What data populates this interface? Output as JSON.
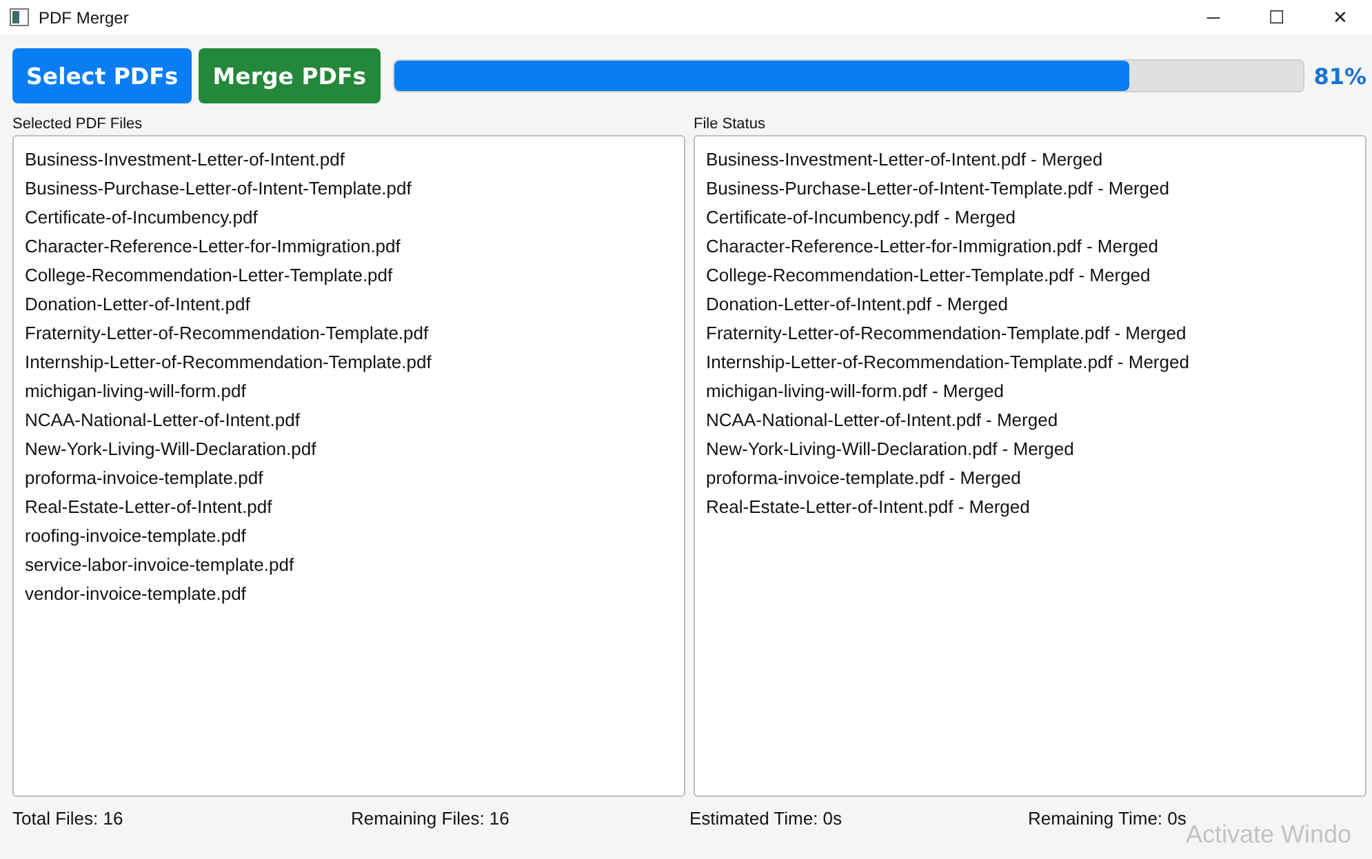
{
  "window": {
    "title": "PDF Merger",
    "controls": [
      "─",
      "☐",
      "✕"
    ]
  },
  "toolbar": {
    "buttons": [
      {
        "label": "Select PDFs",
        "kind": "primary"
      },
      {
        "label": "Merge PDFs",
        "kind": "success"
      }
    ],
    "progress": {
      "level": 0.81,
      "reading": "81%"
    }
  },
  "selected_files": {
    "label": "Selected PDF Files",
    "items": [
      "Business-Investment-Letter-of-Intent.pdf",
      "Business-Purchase-Letter-of-Intent-Template.pdf",
      "Certificate-of-Incumbency.pdf",
      "Character-Reference-Letter-for-Immigration.pdf",
      "College-Recommendation-Letter-Template.pdf",
      "Donation-Letter-of-Intent.pdf",
      "Fraternity-Letter-of-Recommendation-Template.pdf",
      "Internship-Letter-of-Recommendation-Template.pdf",
      "michigan-living-will-form.pdf",
      "NCAA-National-Letter-of-Intent.pdf",
      "New-York-Living-Will-Declaration.pdf",
      "proforma-invoice-template.pdf",
      "Real-Estate-Letter-of-Intent.pdf",
      "roofing-invoice-template.pdf",
      "service-labor-invoice-template.pdf",
      "vendor-invoice-template.pdf"
    ]
  },
  "file_status": {
    "label": "File Status",
    "items": [
      "Business-Investment-Letter-of-Intent.pdf - Merged",
      "Business-Purchase-Letter-of-Intent-Template.pdf - Merged",
      "Certificate-of-Incumbency.pdf - Merged",
      "Character-Reference-Letter-for-Immigration.pdf - Merged",
      "College-Recommendation-Letter-Template.pdf - Merged",
      "Donation-Letter-of-Intent.pdf - Merged",
      "Fraternity-Letter-of-Recommendation-Template.pdf - Merged",
      "Internship-Letter-of-Recommendation-Template.pdf - Merged",
      "michigan-living-will-form.pdf - Merged",
      "NCAA-National-Letter-of-Intent.pdf - Merged",
      "New-York-Living-Will-Declaration.pdf - Merged",
      "proforma-invoice-template.pdf - Merged",
      "Real-Estate-Letter-of-Intent.pdf - Merged"
    ]
  },
  "status_bar": [
    "Total Files: 16",
    "Remaining Files: 16",
    "Estimated Time: 0s",
    "Remaining Time: 0s"
  ],
  "os_overlay": "Activate Windo"
}
